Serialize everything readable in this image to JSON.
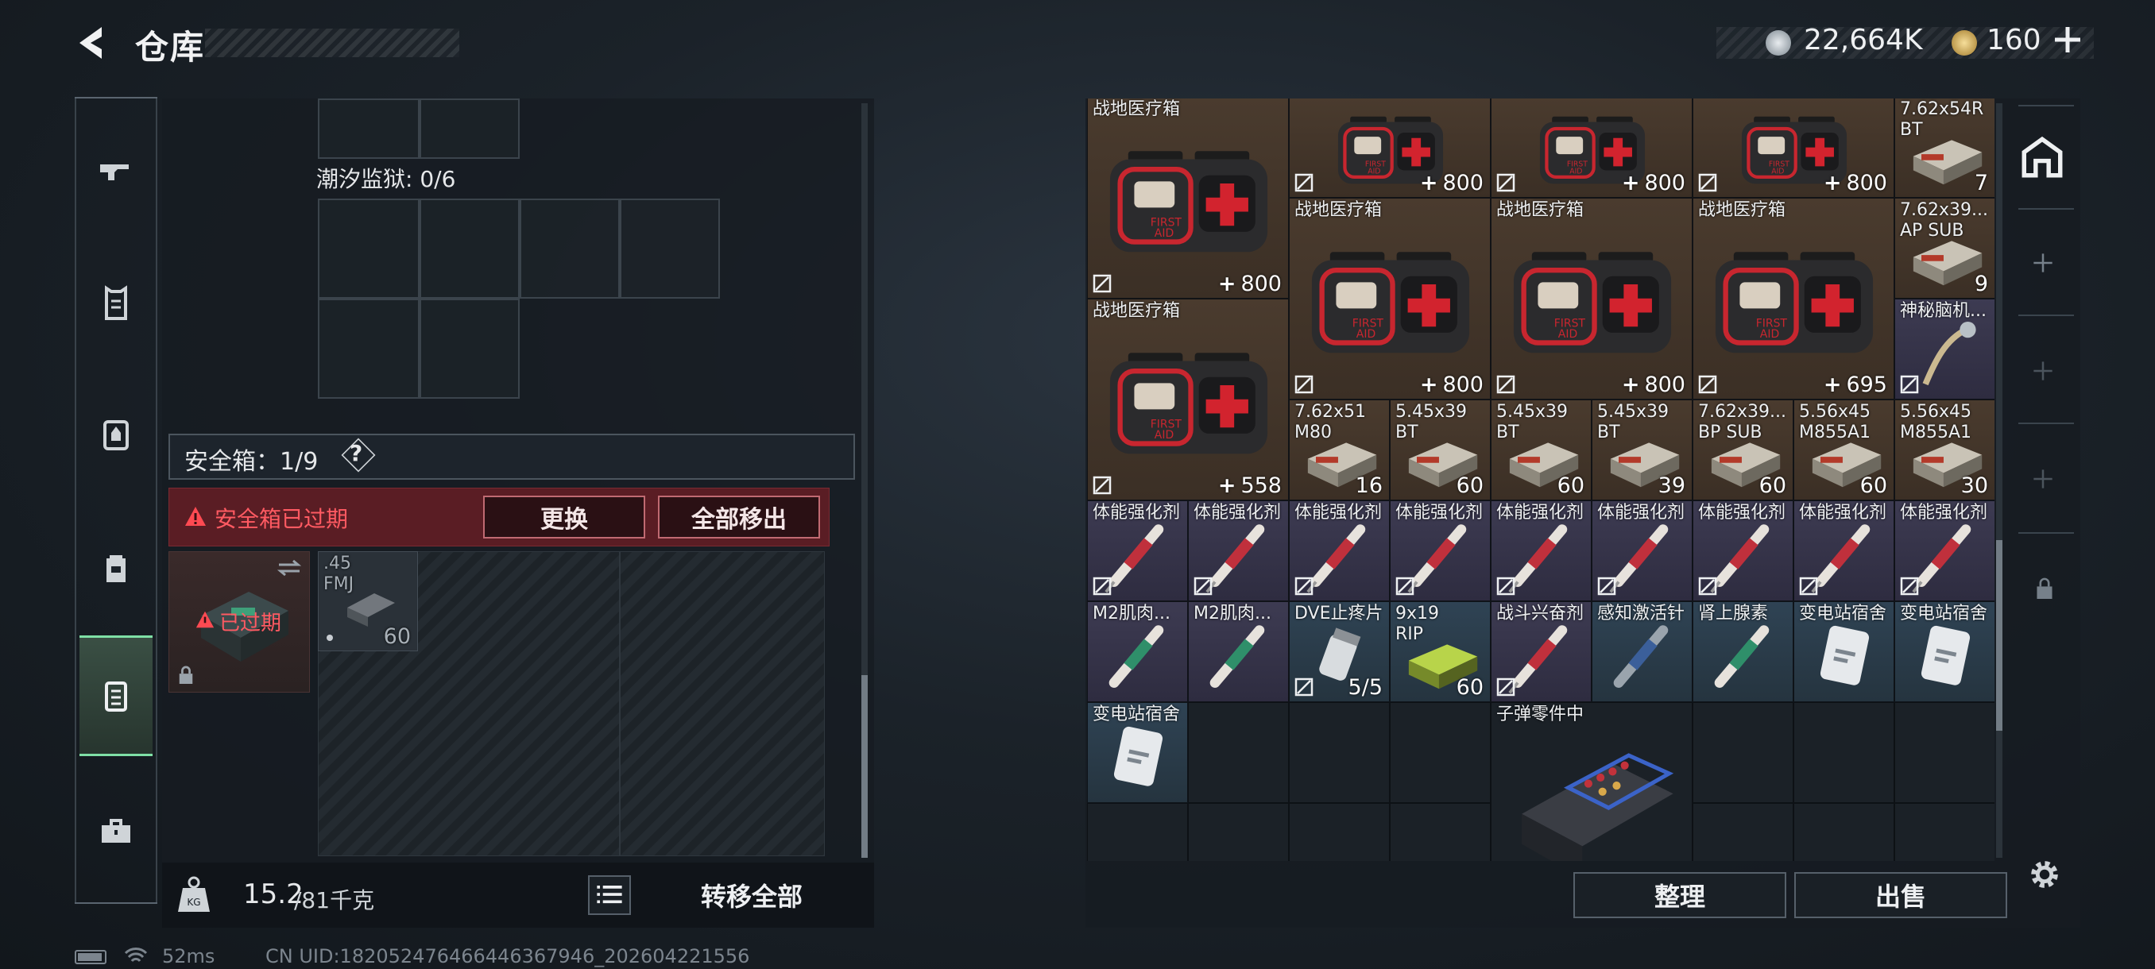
{
  "header": {
    "title": "仓库",
    "currency1": "22,664K",
    "currency2": "160"
  },
  "nav": {
    "items": [
      "weapon-icon",
      "armor-vest-icon",
      "chest-rig-icon",
      "backpack-icon",
      "secure-container-icon",
      "toolbox-icon"
    ],
    "active_index": 4
  },
  "left": {
    "tide_prison_label": "潮汐监狱: 0/6",
    "safe_box_label": "安全箱：1/9",
    "safe_box_help": "?",
    "expired_warning": "安全箱已过期",
    "replace_button": "更换",
    "move_all_out_button": "全部移出",
    "container_status": "已过期",
    "safe_item": {
      "name": ".45\nFMJ",
      "count": "60"
    },
    "weight_value": "15.2",
    "weight_max": "/81千克",
    "transfer_all_button": "转移全部"
  },
  "right": {
    "items": [
      {
        "name": "",
        "count": "800"
      },
      {
        "name": "",
        "count": "800"
      },
      {
        "name": "",
        "count": "800"
      },
      {
        "name": "7.62x54R\nBT",
        "count": "7"
      },
      {
        "name": "战地医疗箱",
        "count": "800"
      },
      {
        "name": "战地医疗箱",
        "count": "800"
      },
      {
        "name": "战地医疗箱",
        "count": "800"
      },
      {
        "name": "战地医疗箱",
        "count": "695"
      },
      {
        "name": "7.62x39...\nAP SUB",
        "count": "9"
      },
      {
        "name": "神秘脑机...",
        "count": ""
      },
      {
        "name": "战地医疗箱",
        "count": "558"
      },
      {
        "name": "7.62x51\nM80",
        "count": "16"
      },
      {
        "name": "5.45x39\nBT",
        "count": "60"
      },
      {
        "name": "5.45x39\nBT",
        "count": "60"
      },
      {
        "name": "5.45x39\nBT",
        "count": "39"
      },
      {
        "name": "7.62x39...\nBP SUB",
        "count": "60"
      },
      {
        "name": "5.56x45\nM855A1",
        "count": "60"
      },
      {
        "name": "5.56x45\nM855A1",
        "count": "30"
      },
      {
        "name": "体能强化剂",
        "count": ""
      },
      {
        "name": "体能强化剂",
        "count": ""
      },
      {
        "name": "体能强化剂",
        "count": ""
      },
      {
        "name": "体能强化剂",
        "count": ""
      },
      {
        "name": "体能强化剂",
        "count": ""
      },
      {
        "name": "体能强化剂",
        "count": ""
      },
      {
        "name": "体能强化剂",
        "count": ""
      },
      {
        "name": "体能强化剂",
        "count": ""
      },
      {
        "name": "体能强化剂",
        "count": ""
      },
      {
        "name": "M2肌肉...",
        "count": ""
      },
      {
        "name": "M2肌肉...",
        "count": ""
      },
      {
        "name": "DVE止疼片",
        "count": "5/5"
      },
      {
        "name": "9x19\nRIP",
        "count": "60"
      },
      {
        "name": "战斗兴奋剂",
        "count": ""
      },
      {
        "name": "感知激活针",
        "count": ""
      },
      {
        "name": "肾上腺素",
        "count": ""
      },
      {
        "name": "变电站宿舍",
        "count": ""
      },
      {
        "name": "变电站宿舍",
        "count": ""
      },
      {
        "name": "变电站宿舍",
        "count": ""
      },
      {
        "name": "子弹零件中",
        "count": ""
      }
    ],
    "sort_button": "整理",
    "sell_button": "出售"
  },
  "footer": {
    "ping": "52ms",
    "uid": "CN UID:182052476466446367946_202604221556"
  },
  "colors": {
    "accent": "#7fe0a6",
    "warning": "#e0363f",
    "panel": "#161c22"
  }
}
